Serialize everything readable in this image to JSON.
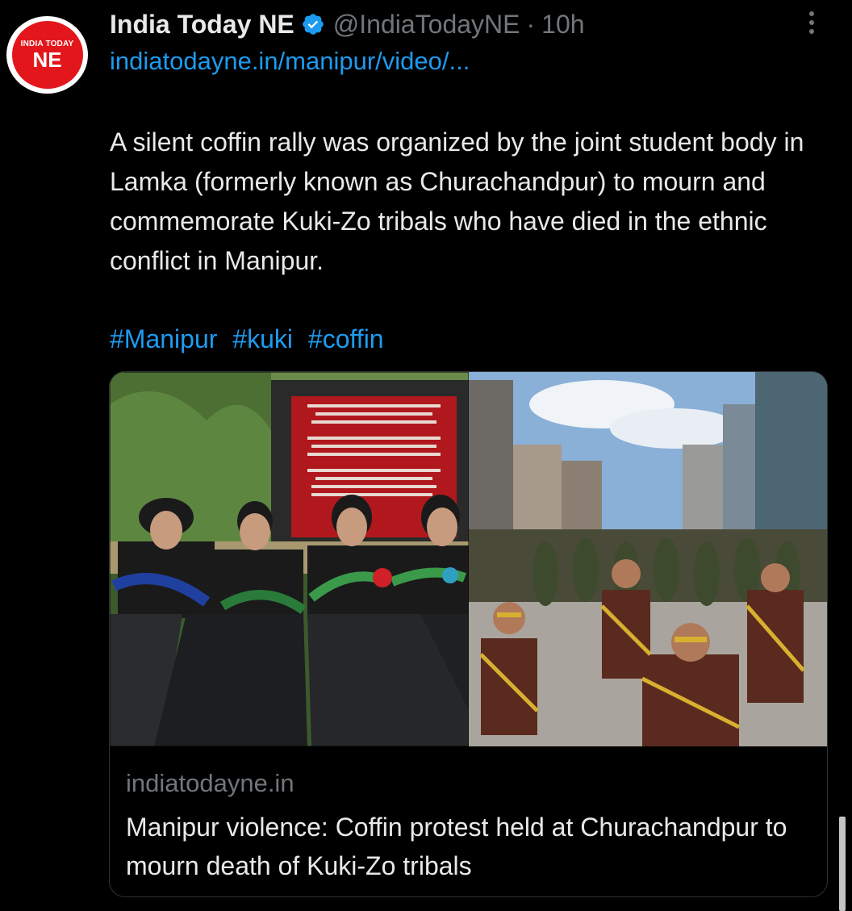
{
  "author": {
    "name": "India Today NE",
    "handle": "@IndiaTodayNE",
    "separator": "·",
    "time": "10h",
    "avatar_logo_top": "INDIA TODAY",
    "avatar_logo_bottom": "NE",
    "verified_icon": "verified-badge-icon",
    "brand_color": "#e3171b"
  },
  "tweet": {
    "link": "indiatodayne.in/manipur/video/...",
    "text": "A silent coffin rally was organized by the joint student body in Lamka (formerly known as Churachandpur) to mourn and commemorate Kuki-Zo tribals who have died in the ethnic conflict in Manipur.",
    "hashtags": [
      "#Manipur",
      "#kuki",
      "#coffin"
    ]
  },
  "card": {
    "domain": "indiatodayne.in",
    "title": "Manipur violence: Coffin protest held at Churachandpur to mourn death of Kuki-Zo tribals"
  },
  "colors": {
    "link": "#1d9bf0",
    "text": "#e7e9ea",
    "muted": "#71767b",
    "border": "#2f3336"
  }
}
